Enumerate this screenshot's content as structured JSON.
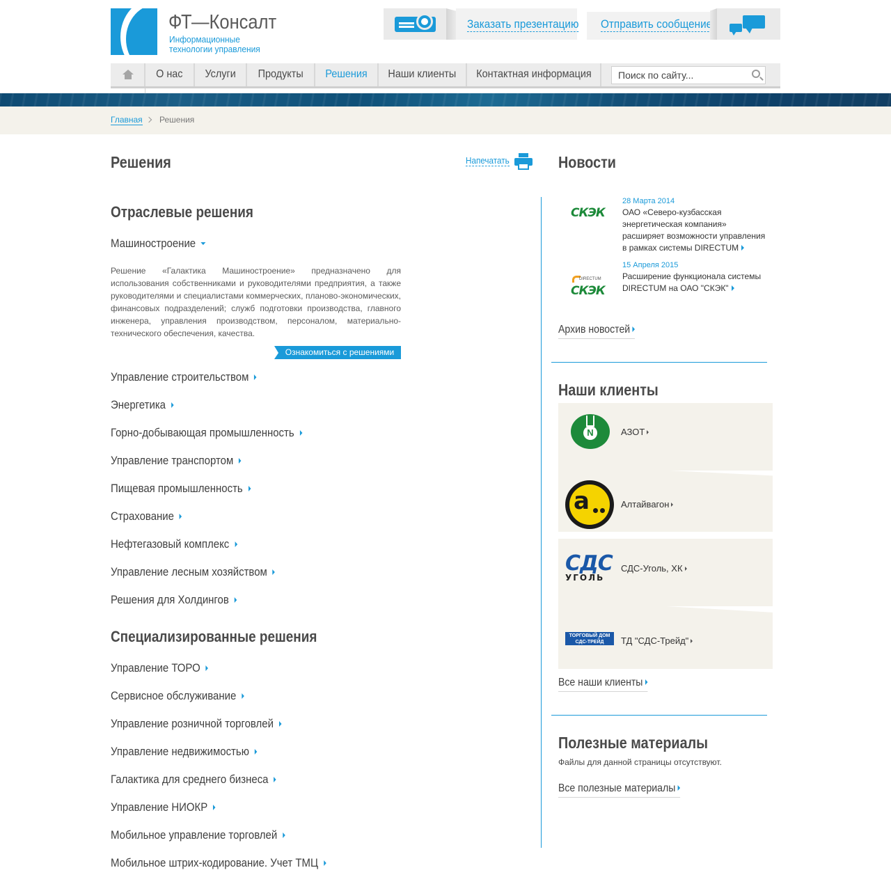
{
  "header": {
    "logo_title": "ФТ—Консалт",
    "logo_subtitle_line1": "Информационные",
    "logo_subtitle_line2": "технологии управления",
    "order_presentation": "Заказать презентацию",
    "send_message": "Отправить сообщение"
  },
  "nav": {
    "items": [
      "О нас",
      "Услуги",
      "Продукты",
      "Решения",
      "Наши клиенты",
      "Контактная информация"
    ],
    "active": "Решения",
    "search_value": "Поиск по сайту..."
  },
  "breadcrumb": {
    "home": "Главная",
    "current": "Решения"
  },
  "main": {
    "title": "Решения",
    "print_label": "Напечатать",
    "industry_heading": "Отраслевые решения",
    "expanded_item": "Машиностроение",
    "expanded_description": "Решение «Галактика Машиностроение» предназначено для использования собственниками и руководителями предприятия, а также руководителями и специалистами коммерческих, планово-экономических, финансовых подразделений; служб подготовки производства, главного инженера, управления производством, персоналом, материально-технического обеспечения, качества.",
    "expanded_button": "Ознакомиться с решениями",
    "industry_items": [
      "Управление строительством",
      "Энергетика",
      "Горно-добывающая промышленность",
      "Управление транспортом",
      "Пищевая промышленность",
      "Страхование",
      "Нефтегазовый комплекс",
      "Управление лесным хозяйством",
      "Решения для Холдингов"
    ],
    "special_heading": "Специализированные решения",
    "special_items": [
      "Управление ТОРО",
      "Сервисное обслуживание",
      "Управление розничной торговлей",
      "Управление недвижимостью",
      "Галактика для среднего бизнеса",
      "Управление НИОКР",
      "Мобильное управление торговлей",
      "Мобильное штрих-кодирование. Учет ТМЦ"
    ]
  },
  "sidebar": {
    "news_heading": "Новости",
    "news": [
      {
        "date": "28 Марта 2014",
        "text": "ОАО «Северо-кузбасская энергетическая компания» расширяет возможности управления в рамках системы DIRECTUM",
        "logo_text": "СКЭК"
      },
      {
        "date": "15 Апреля 2015",
        "text": "Расширение функционала системы DIRECTUM на ОАО \"СКЭК\"",
        "logo_text": "СКЭК",
        "logo_caption": "DIRECTUM"
      }
    ],
    "news_archive": "Архив новостей",
    "clients_heading": "Наши клиенты",
    "clients": [
      {
        "name": "АЗОТ",
        "logo": "N"
      },
      {
        "name": "Алтайвагон",
        "logo": "а"
      },
      {
        "name": "СДС-Уголь, ХК",
        "logo_big": "СДС",
        "logo_small": "УГОЛЬ"
      },
      {
        "name": "ТД \"СДС-Трейд\"",
        "logo_line1": "ТОРГОВЫЙ ДОМ",
        "logo_line2": "СДС-ТРЕЙД"
      }
    ],
    "all_clients": "Все наши клиенты",
    "materials_heading": "Полезные материалы",
    "materials_empty": "Файлы для данной страницы отсутствуют.",
    "all_materials": "Все полезные материалы"
  },
  "colors": {
    "accent": "#1a9ad9",
    "text": "#3f3f3f",
    "card_bg": "#f4f2eb",
    "nav_bg": "#ececec"
  }
}
